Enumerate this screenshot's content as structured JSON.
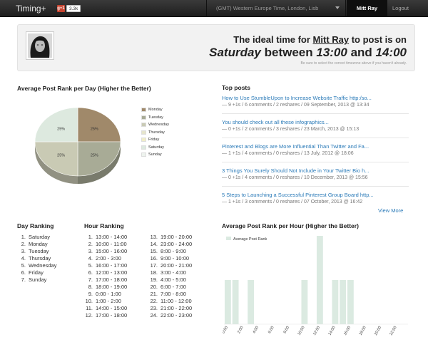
{
  "nav": {
    "brand": "Timing+",
    "gplus_label": "g+1",
    "gplus_count": "3.3k",
    "timezone": "(GMT) Western Europe Time, London, Lisb",
    "user": "Mitt Ray",
    "logout": "Logout"
  },
  "hero": {
    "line1_prefix": "The ideal time for ",
    "user": "Mitt Ray",
    "line1_suffix": " to post is on",
    "day": "Saturday",
    "between": " between ",
    "start": "13:00",
    "and": " and ",
    "end": "14:00",
    "note": "Be sure to select the correct timezone above if you haven't already."
  },
  "pie_section": {
    "title": "Average Post Rank per Day (Higher the Better)"
  },
  "top_posts": {
    "title": "Top posts",
    "view_more": "View More",
    "items": [
      {
        "title": "How to Use StumbleUpon to Increase Website Traffic http:/so...",
        "meta": "— 9 +1s / 6 comments / 2 reshares / 09 September, 2013 @ 13:34"
      },
      {
        "title": "You should check out all these infographics...",
        "meta": "— 0 +1s / 2 comments / 3 reshares / 23 March, 2013 @ 15:13"
      },
      {
        "title": "Pinterest and Blogs are More Influential Than Twitter and Fa...",
        "meta": "— 1 +1s / 4 comments / 0 reshares / 13 July, 2012 @ 18:06"
      },
      {
        "title": "3 Things You Surely Should Not Include in Your Twitter Bio h...",
        "meta": "— 0 +1s / 4 comments / 0 reshares / 10 December, 2013 @ 15:56"
      },
      {
        "title": "5 Steps to Launching a Successful Pinterest Group Board http...",
        "meta": "— 1 +1s / 3 comments / 0 reshares / 07 October, 2013 @ 16:42"
      }
    ]
  },
  "day_ranking": {
    "title": "Day Ranking",
    "items": [
      "Saturday",
      "Monday",
      "Tuesday",
      "Thursday",
      "Wednesday",
      "Friday",
      "Sunday"
    ]
  },
  "hour_ranking": {
    "title": "Hour Ranking",
    "items": [
      "13:00 - 14:00",
      "10:00 - 11:00",
      "15:00 - 16:00",
      "2:00 - 3:00",
      "16:00 - 17:00",
      "12:00 - 13:00",
      "17:00 - 18:00",
      "18:00 - 19:00",
      "0:00 - 1:00",
      "1:00 - 2:00",
      "14:00 - 15:00",
      "17:00 - 18:00",
      "19:00 - 20:00",
      "23:00 - 24:00",
      "8:00 - 9:00",
      "9:00 - 10:00",
      "20:00 - 21:00",
      "3:00 - 4:00",
      "4:00 - 5:00",
      "6:00 - 7:00",
      "7:00 - 8:00",
      "11:00 - 12:00",
      "21:00 - 22:00",
      "22:00 - 23:00"
    ]
  },
  "chart_data": [
    {
      "type": "pie",
      "title": "Average Post Rank per Day (Higher the Better)",
      "categories": [
        "Monday",
        "Tuesday",
        "Wednesday",
        "Thursday",
        "Friday",
        "Saturday",
        "Sunday"
      ],
      "values": [
        25,
        25,
        25,
        0,
        0,
        25,
        0
      ],
      "slice_labels": [
        "25%",
        "25%",
        "25%",
        "25%"
      ],
      "colors": [
        "#a0896a",
        "#a8ab96",
        "#c9cab4",
        "#e6e5cc",
        "#f1edc8",
        "#dde9df",
        "#eef3ee"
      ],
      "legend_position": "right"
    },
    {
      "type": "bar",
      "title": "Average Post Rank per Hour (Higher the Better)",
      "series": [
        {
          "name": "Average Post Rank",
          "values": [
            1,
            1,
            0,
            1,
            0,
            0,
            0,
            0,
            0,
            0,
            1,
            0,
            2,
            0,
            1,
            1,
            1,
            0,
            0,
            0,
            0,
            0,
            0,
            0
          ]
        }
      ],
      "x": [
        "0:00",
        "1:00",
        "2:00",
        "3:00",
        "4:00",
        "5:00",
        "6:00",
        "7:00",
        "8:00",
        "9:00",
        "10:00",
        "11:00",
        "12:00",
        "13:00",
        "14:00",
        "15:00",
        "16:00",
        "17:00",
        "18:00",
        "19:00",
        "20:00",
        "21:00",
        "22:00",
        "23:00"
      ],
      "tick_labels": [
        "0:00",
        "2:00",
        "4:00",
        "6:00",
        "8:00",
        "10:00",
        "12:00",
        "14:00",
        "16:00",
        "18:00",
        "20:00",
        "22:00"
      ],
      "ylim": [
        0,
        2
      ],
      "color": "#dbeae1",
      "legend_position": "top-left"
    }
  ]
}
